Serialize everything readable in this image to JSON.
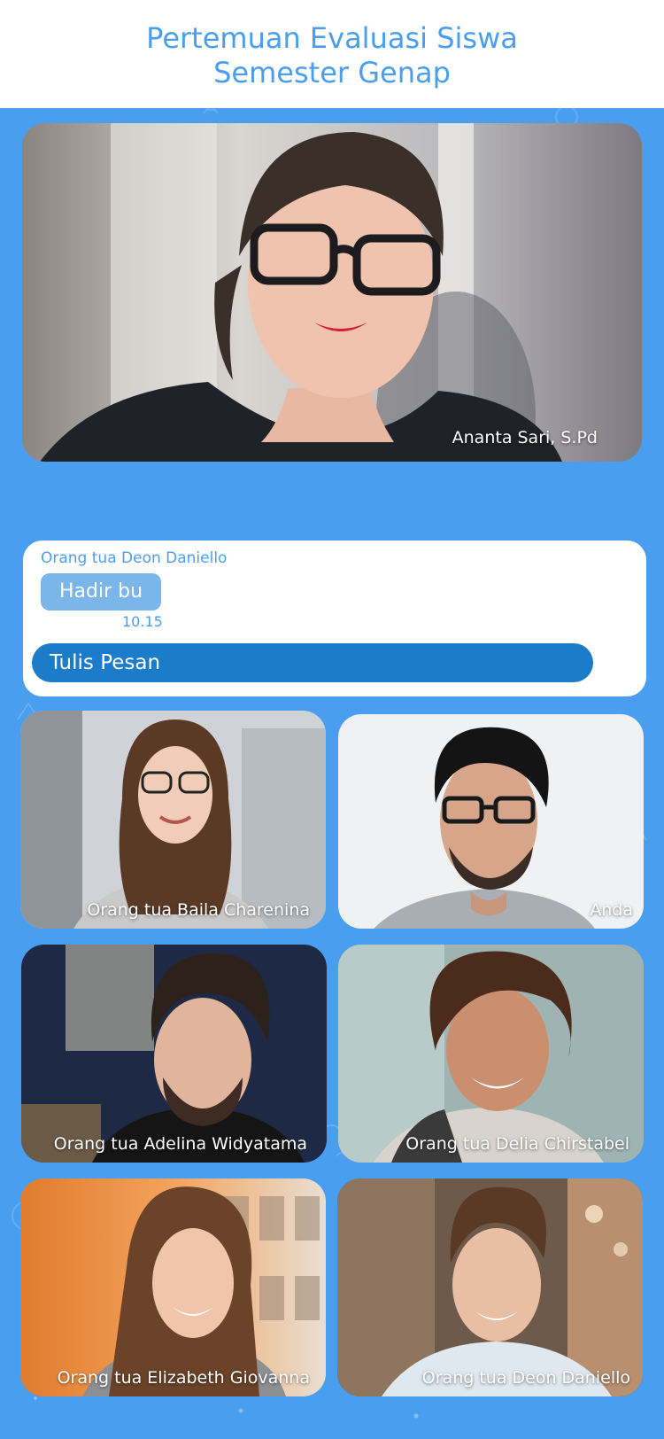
{
  "meeting": {
    "title_line1": "Pertemuan Evaluasi Siswa",
    "title_line2": "Semester Genap"
  },
  "teacher": {
    "name": "Ananta Sari, S.Pd"
  },
  "chat": {
    "sender": "Orang tua Deon Daniello",
    "message": "Hadir bu",
    "time": "10.15",
    "input_placeholder": "Tulis Pesan"
  },
  "participants": [
    {
      "name": "Orang tua Baila Charenina"
    },
    {
      "name": "Anda"
    },
    {
      "name": "Orang tua Adelina Widyatama"
    },
    {
      "name": "Orang tua Delia Chirstabel"
    },
    {
      "name": "Orang tua Elizabeth Giovanna"
    },
    {
      "name": "Orang tua Deon Daniello"
    }
  ],
  "colors": {
    "background": "#4a9ef0",
    "header_bg": "#ffffff",
    "title_text": "#4a9ef0",
    "bubble": "#7ab6ea",
    "input": "#1d7cc9"
  }
}
